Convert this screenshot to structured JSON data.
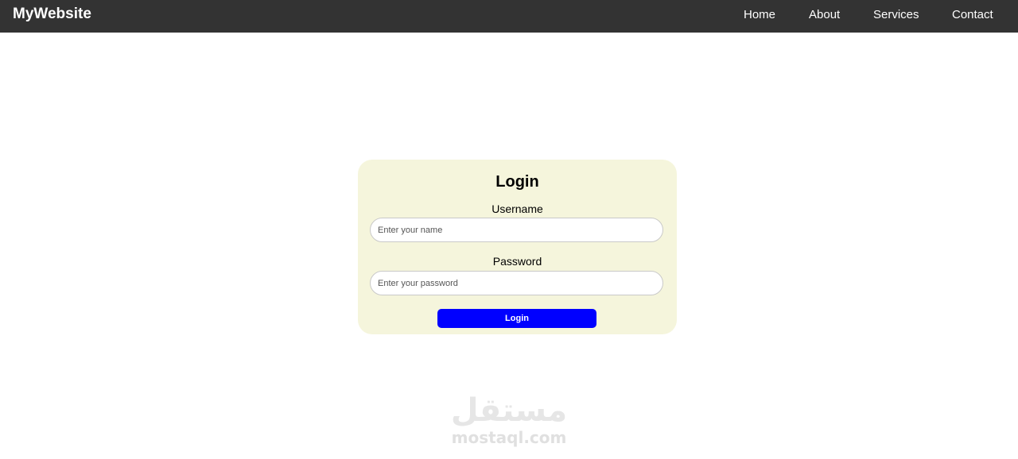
{
  "header": {
    "brand": "MyWebsite",
    "nav": [
      "Home",
      "About",
      "Services",
      "Contact"
    ]
  },
  "login_form": {
    "title": "Login",
    "username_label": "Username",
    "username_placeholder": "Enter your name",
    "username_value": "",
    "password_label": "Password",
    "password_placeholder": "Enter your password",
    "password_value": "",
    "submit_label": "Login"
  },
  "watermark": {
    "arabic": "مستقل",
    "latin": "mostaql.com"
  },
  "colors": {
    "navbar_bg": "#333333",
    "card_bg": "#f5f5dc",
    "button_bg": "#0000ff"
  }
}
